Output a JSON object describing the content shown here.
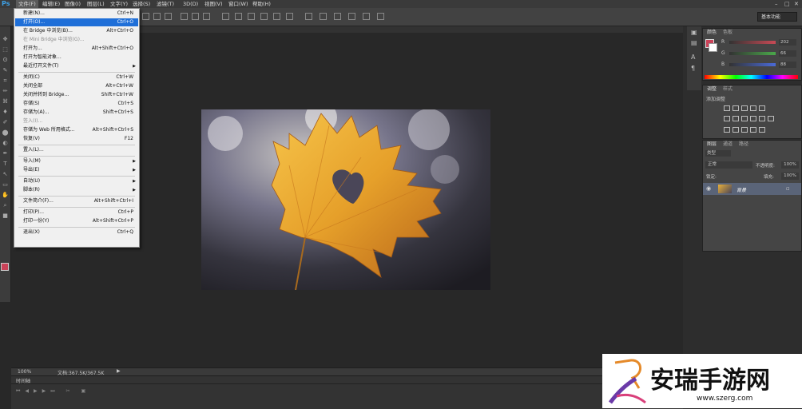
{
  "app": {
    "logo": "Ps"
  },
  "menubar": [
    "文件(F)",
    "编辑(E)",
    "图像(I)",
    "图层(L)",
    "文字(Y)",
    "选择(S)",
    "滤镜(T)",
    "3D(D)",
    "视图(V)",
    "窗口(W)",
    "帮助(H)"
  ],
  "workspace": {
    "label": "基本功能"
  },
  "file_menu": {
    "items": [
      {
        "label": "新建(N)...",
        "shortcut": "Ctrl+N",
        "disabled": false,
        "highlighted": false,
        "submenu": false
      },
      {
        "label": "打开(O)...",
        "shortcut": "Ctrl+O",
        "disabled": false,
        "highlighted": true,
        "submenu": false
      },
      {
        "label": "在 Bridge 中浏览(B)...",
        "shortcut": "Alt+Ctrl+O",
        "disabled": false,
        "highlighted": false,
        "submenu": false
      },
      {
        "label": "在 Mini Bridge 中浏览(G)...",
        "shortcut": "",
        "disabled": true,
        "highlighted": false,
        "submenu": false
      },
      {
        "label": "打开为...",
        "shortcut": "Alt+Shift+Ctrl+O",
        "disabled": false,
        "highlighted": false,
        "submenu": false
      },
      {
        "label": "打开为智能对象...",
        "shortcut": "",
        "disabled": false,
        "highlighted": false,
        "submenu": false
      },
      {
        "label": "最近打开文件(T)",
        "shortcut": "",
        "disabled": false,
        "highlighted": false,
        "submenu": true
      },
      {
        "sep": true
      },
      {
        "label": "关闭(C)",
        "shortcut": "Ctrl+W",
        "disabled": false,
        "highlighted": false,
        "submenu": false
      },
      {
        "label": "关闭全部",
        "shortcut": "Alt+Ctrl+W",
        "disabled": false,
        "highlighted": false,
        "submenu": false
      },
      {
        "label": "关闭并转到 Bridge...",
        "shortcut": "Shift+Ctrl+W",
        "disabled": false,
        "highlighted": false,
        "submenu": false
      },
      {
        "label": "存储(S)",
        "shortcut": "Ctrl+S",
        "disabled": false,
        "highlighted": false,
        "submenu": false
      },
      {
        "label": "存储为(A)...",
        "shortcut": "Shift+Ctrl+S",
        "disabled": false,
        "highlighted": false,
        "submenu": false
      },
      {
        "label": "签入(I)...",
        "shortcut": "",
        "disabled": true,
        "highlighted": false,
        "submenu": false
      },
      {
        "label": "存储为 Web 所用格式...",
        "shortcut": "Alt+Shift+Ctrl+S",
        "disabled": false,
        "highlighted": false,
        "submenu": false
      },
      {
        "label": "恢复(V)",
        "shortcut": "F12",
        "disabled": false,
        "highlighted": false,
        "submenu": false
      },
      {
        "sep": true
      },
      {
        "label": "置入(L)...",
        "shortcut": "",
        "disabled": false,
        "highlighted": false,
        "submenu": false
      },
      {
        "sep": true
      },
      {
        "label": "导入(M)",
        "shortcut": "",
        "disabled": false,
        "highlighted": false,
        "submenu": true
      },
      {
        "label": "导出(E)",
        "shortcut": "",
        "disabled": false,
        "highlighted": false,
        "submenu": true
      },
      {
        "sep": true
      },
      {
        "label": "自动(U)",
        "shortcut": "",
        "disabled": false,
        "highlighted": false,
        "submenu": true
      },
      {
        "label": "脚本(R)",
        "shortcut": "",
        "disabled": false,
        "highlighted": false,
        "submenu": true
      },
      {
        "sep": true
      },
      {
        "label": "文件简介(F)...",
        "shortcut": "Alt+Shift+Ctrl+I",
        "disabled": false,
        "highlighted": false,
        "submenu": false
      },
      {
        "sep": true
      },
      {
        "label": "打印(P)...",
        "shortcut": "Ctrl+P",
        "disabled": false,
        "highlighted": false,
        "submenu": false
      },
      {
        "label": "打印一份(Y)",
        "shortcut": "Alt+Shift+Ctrl+P",
        "disabled": false,
        "highlighted": false,
        "submenu": false
      },
      {
        "sep": true
      },
      {
        "label": "退出(X)",
        "shortcut": "Ctrl+Q",
        "disabled": false,
        "highlighted": false,
        "submenu": false
      }
    ]
  },
  "status": {
    "zoom": "100%",
    "doc": "文档:367.5K/367.5K"
  },
  "timeline": {
    "title": "时间轴"
  },
  "color_panel": {
    "tabs": [
      "颜色",
      "色板"
    ],
    "channels": [
      {
        "label": "R",
        "value": "202",
        "color": "#c84a55"
      },
      {
        "label": "G",
        "value": "66",
        "color": "#4aa84a"
      },
      {
        "label": "B",
        "value": "88",
        "color": "#4a6ad8"
      }
    ],
    "foreground": "#ca4258"
  },
  "adjust_panel": {
    "tabs": [
      "调整",
      "样式"
    ],
    "title": "添加调整"
  },
  "layers_panel": {
    "tabs": [
      "图层",
      "通道",
      "路径"
    ],
    "kind": "类型",
    "blend_mode": "正常",
    "opacity_label": "不透明度:",
    "opacity": "100%",
    "lock_label": "锁定:",
    "fill_label": "填充:",
    "fill": "100%",
    "layers": [
      {
        "name": "背景",
        "locked": true,
        "visible": true
      }
    ]
  },
  "watermark": {
    "brand": "安瑞手游网",
    "url": "www.szerg.com"
  }
}
